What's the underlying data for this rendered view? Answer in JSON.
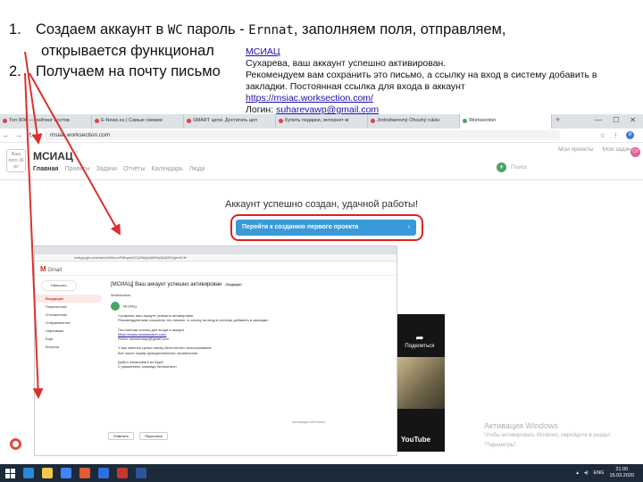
{
  "instructions": {
    "step1_num": "1.",
    "step1_text_a": "Создаем аккаунт в ",
    "step1_code_a": "WC",
    "step1_text_b": " пароль - ",
    "step1_code_b": "Ernnat",
    "step1_text_c": ", заполняем поля, отправляем,",
    "step1_line2": "открывается функционал",
    "step2_num": "2.",
    "step2_text": "Получаем на почту письмо"
  },
  "email_note": {
    "sender_link": "МСИАЦ",
    "line1": "Сухарева, ваш аккаунт успешно активирован.",
    "line2": "Рекомендуем вам сохранить это письмо, а ссылку на вход в систему добавить в",
    "line3": "закладки. Постоянная ссылка для входа в аккаунт",
    "account_url": "https://msiac.worksection.com/",
    "login_label": "Логин: ",
    "login_value": "suharevawp@gmail.com"
  },
  "browser": {
    "tabs": [
      {
        "label": "Топ ЖЖ — рейтинг постов"
      },
      {
        "label": "E-News.su | Самые свежие"
      },
      {
        "label": "SMART цели. Достигать цел"
      },
      {
        "label": "Купить подарки, интернет-м"
      },
      {
        "label": "Jednobarevný Ohouhý rukáv"
      },
      {
        "label": "Worksection"
      }
    ],
    "url": "msiac.worksection.com",
    "new_tab": "+",
    "window_controls": [
      "—",
      "☐",
      "✕"
    ],
    "profile_initial": "И"
  },
  "workspace": {
    "logo_text": "Ваш лого 36 px",
    "company_name": "МСИАЦ",
    "nav": [
      "Главная",
      "Проекты",
      "Задачи",
      "Отчёты",
      "Календарь",
      "Люди"
    ],
    "top_right": [
      "Мои проекты",
      "Мои задачи"
    ],
    "search_placeholder": "Поиск",
    "add_icon": "+",
    "avatar_initial": "СУ"
  },
  "main": {
    "success_message": "Аккаунт успешно создан, удачной работы!",
    "create_project_button": "Перейти к созданию первого проекта",
    "button_chevron": "›"
  },
  "gmail": {
    "address": "mail.google.com/mail/u/0/#inbox/FMfcgxwGCQZWqQnAfMSqIQldj3SVQgbnKCM",
    "app_name": "Gmail",
    "compose": "Написать",
    "folders": [
      "Входящие",
      "Помеченные",
      "Отложенные",
      "Отправленные",
      "Черновики",
      "Ещё",
      "Встречи"
    ],
    "subject": "[МСИАЦ] Ваш аккаунт успешно активирован",
    "subject_label": "Входящие",
    "from": "Worksection",
    "sender_name": "МСИАЦ",
    "body": [
      "Сухарева, ваш аккаунт успешно активирован.",
      "Рекомендуем вам сохранить это письмо, а ссылку на вход в систему добавить в закладки.",
      "Постоянная ссылка для входа в аккаунт",
      "https://msiac.worksection.com/",
      "Логин: suharevawp@gmail.com",
      "У вас имеется целых месяц бесплатного использования",
      "Все через тариф функциональные ограничения",
      "Добро пожаловать во Бурс!",
      "С уважением, команда Worksection"
    ],
    "reply": "Ответить",
    "forward": "Переслать",
    "activation_notice": "Активация Windows"
  },
  "video": {
    "share_label": "Поделиться",
    "share_icon": "share-arrow",
    "brand": "YouTube"
  },
  "windows_activation": {
    "title": "Активация Windows",
    "line1": "Чтобы активировать Windows, перейдите в раздел",
    "line2": "\"Параметры\"."
  },
  "taskbar": {
    "lang": "ENG",
    "time": "21:00",
    "date": "15.03.2020",
    "app_colors": [
      "#2b88d8",
      "#f2c94c",
      "#4285f4",
      "#e25c31",
      "#2f6fdd",
      "#c0392b",
      "#2b579a"
    ]
  },
  "colors": {
    "accent_blue": "#3a9ad9",
    "highlight_red": "#e02020",
    "worksection_green": "#4aa563"
  }
}
